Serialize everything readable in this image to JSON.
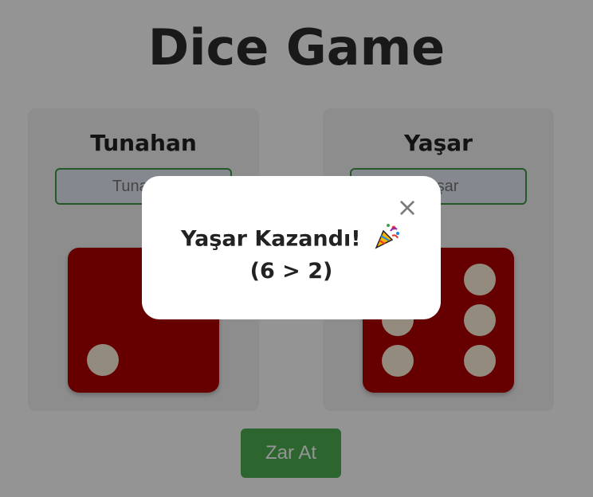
{
  "title": "Dice Game",
  "players": [
    {
      "name": "Tunahan",
      "input_placeholder": "Tunahan",
      "die_value": 2
    },
    {
      "name": "Yaşar",
      "input_placeholder": "Yaşar",
      "die_value": 6
    }
  ],
  "roll_button": {
    "label": "Zar At"
  },
  "modal": {
    "close_label": "×",
    "message": "Yaşar Kazandı!",
    "message_icon": "party-popper-icon",
    "score": "(6 > 2)"
  },
  "colors": {
    "die_face": "#b00000",
    "pip": "#fbf0d9",
    "button": "#4caf50",
    "input_border": "#3d9a46"
  }
}
